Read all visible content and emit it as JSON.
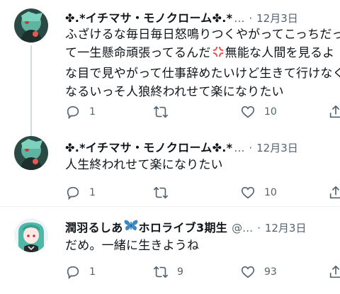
{
  "tweets": [
    {
      "name": "✤.*イチマサ・モノクローム✤.*",
      "handle": "…",
      "dot": "·",
      "time": "12月3日",
      "lines": [
        "ふざけるな毎日毎日怒鳴りつくやがってこっちだっ",
        "て一生懸命頑張ってるんだ",
        "な目で見やがって仕事辞めたいけど生きて行けなく",
        "なるいっそ人狼終われせて楽になりたい"
      ],
      "line2_suffix": "無能な人間を見るよ",
      "replies": "1",
      "retweets": "",
      "likes": "10"
    },
    {
      "name": "✤.*イチマサ・モノクローム✤.*",
      "handle": "…",
      "dot": "·",
      "time": "12月3日",
      "lines": [
        "人生終われせて楽になりたい"
      ],
      "replies": "1",
      "retweets": "",
      "likes": "10"
    },
    {
      "name": "潤羽るしあ",
      "name_suffix": "ホロライブ3期生",
      "handle": "@…",
      "dot": "·",
      "time": "12月3日",
      "lines": [
        "だめ。一緒に生きようね"
      ],
      "replies": "1",
      "retweets": "9",
      "likes": "93"
    }
  ],
  "icons": {
    "reply": "reply-icon",
    "retweet": "retweet-icon",
    "like": "heart-icon",
    "share": "share-icon",
    "anger": "anger-symbol-icon",
    "butterfly": "butterfly-icon"
  },
  "colors": {
    "text": "#0f1419",
    "secondary": "#536471",
    "thread_line": "#cfd9de",
    "anger": "#f4504f",
    "butterfly": "#3b88c3"
  }
}
